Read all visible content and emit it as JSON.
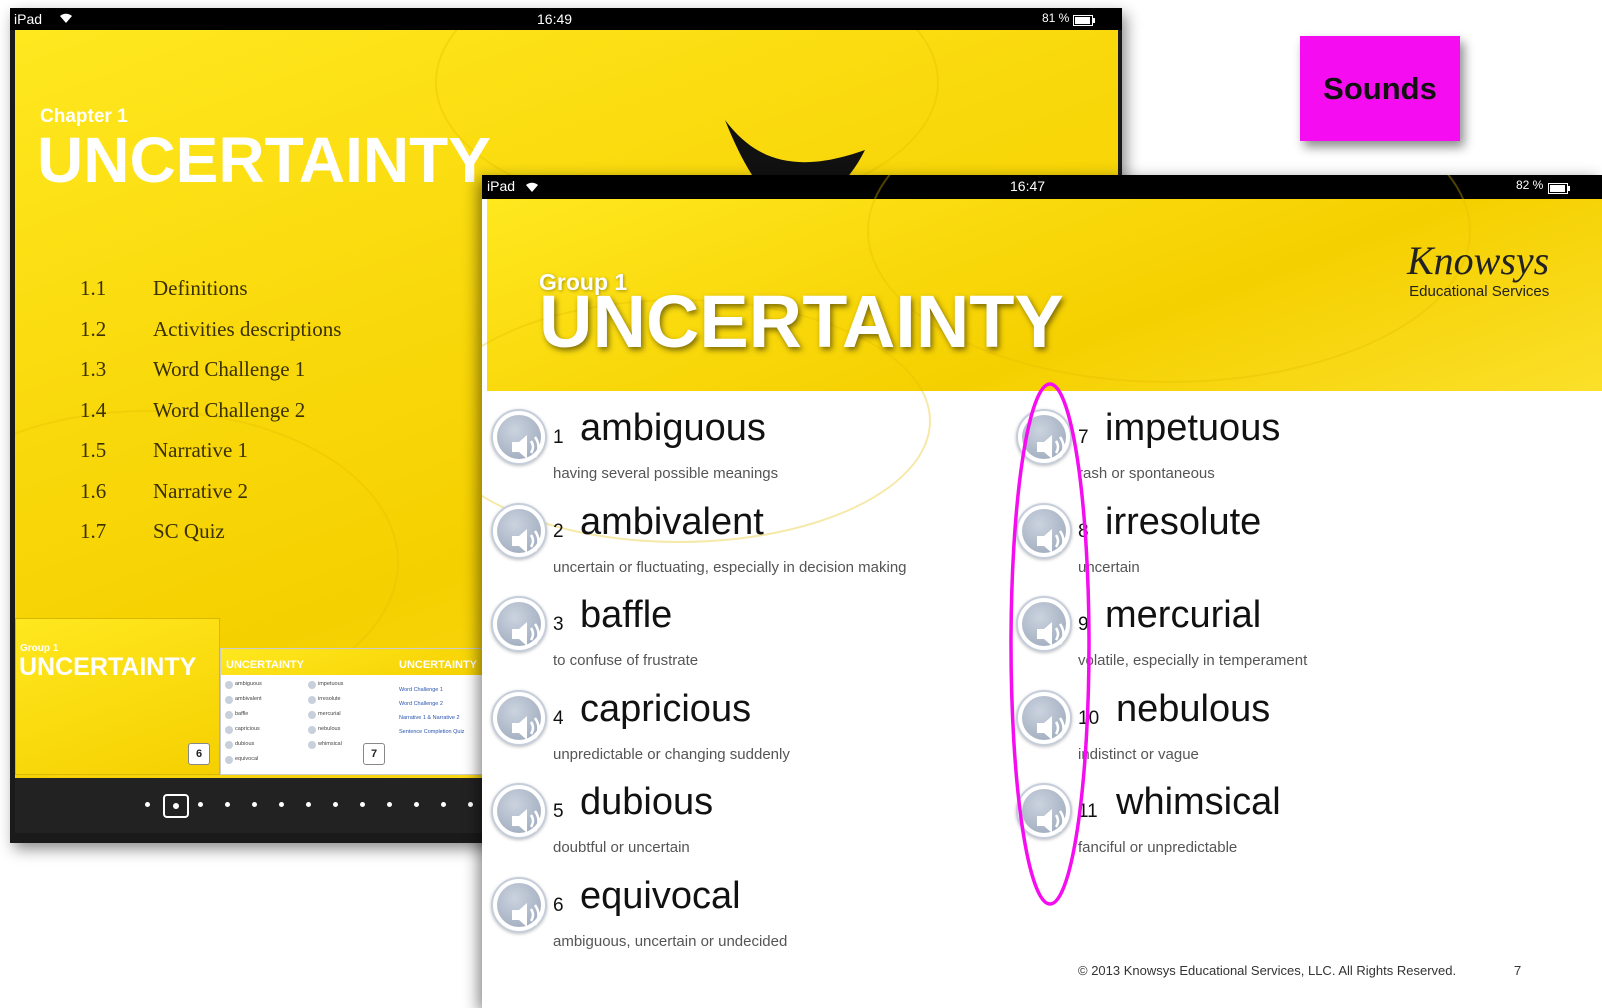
{
  "back": {
    "status": {
      "device": "iPad",
      "time": "16:49",
      "battery": "81 %"
    },
    "chapter_label": "Chapter 1",
    "chapter_title": "UNCERTAINTY",
    "toc": [
      {
        "num": "1.1",
        "label": "Definitions"
      },
      {
        "num": "1.2",
        "label": "Activities descriptions"
      },
      {
        "num": "1.3",
        "label": "Word Challenge 1"
      },
      {
        "num": "1.4",
        "label": "Word Challenge 2"
      },
      {
        "num": "1.5",
        "label": "Narrative 1"
      },
      {
        "num": "1.6",
        "label": "Narrative 2"
      },
      {
        "num": "1.7",
        "label": "SC Quiz"
      }
    ],
    "thumbnails": {
      "t1_group": "Group 1",
      "t1_title": "UNCERTAINTY",
      "t1_page": "6",
      "t2_title": "UNCERTAINTY",
      "t2_title2": "UNCERTAINTY",
      "t2_page": "7",
      "mini_words_left": [
        "ambiguous",
        "ambivalent",
        "baffle",
        "capricious",
        "dubious",
        "equivocal"
      ],
      "mini_words_right": [
        "impetuous",
        "irresolute",
        "mercurial",
        "nebulous",
        "whimsical"
      ],
      "mini_links": [
        "Word Challenge 1",
        "Word Challenge 2",
        "Narrative 1 & Narrative 2",
        "Sentence Completion Quiz"
      ]
    }
  },
  "sounds_label": "Sounds",
  "front": {
    "status": {
      "device": "iPad",
      "time": "16:47",
      "battery": "82 %"
    },
    "group_label": "Group 1",
    "group_title": "UNCERTAINTY",
    "logo": {
      "name": "Knowsys",
      "sub": "Educational Services"
    },
    "words": [
      {
        "num": "1",
        "term": "ambiguous",
        "def": "having several possible meanings"
      },
      {
        "num": "2",
        "term": "ambivalent",
        "def": "uncertain or fluctuating, especially in decision making"
      },
      {
        "num": "3",
        "term": "baffle",
        "def": "to confuse of frustrate"
      },
      {
        "num": "4",
        "term": "capricious",
        "def": "unpredictable or changing suddenly"
      },
      {
        "num": "5",
        "term": "dubious",
        "def": "doubtful or uncertain"
      },
      {
        "num": "6",
        "term": "equivocal",
        "def": "ambiguous, uncertain or undecided"
      },
      {
        "num": "7",
        "term": "impetuous",
        "def": "rash or spontaneous"
      },
      {
        "num": "8",
        "term": "irresolute",
        "def": "uncertain"
      },
      {
        "num": "9",
        "term": "mercurial",
        "def": "volatile, especially in temperament"
      },
      {
        "num": "10",
        "term": "nebulous",
        "def": "indistinct or vague"
      },
      {
        "num": "11",
        "term": "whimsical",
        "def": "fanciful or unpredictable"
      }
    ],
    "copyright": "© 2013 Knowsys Educational Services, LLC. All Rights Reserved.",
    "page_number": "7"
  },
  "colors": {
    "highlight": "#f50cf0",
    "yellow": "#f9d90c"
  }
}
